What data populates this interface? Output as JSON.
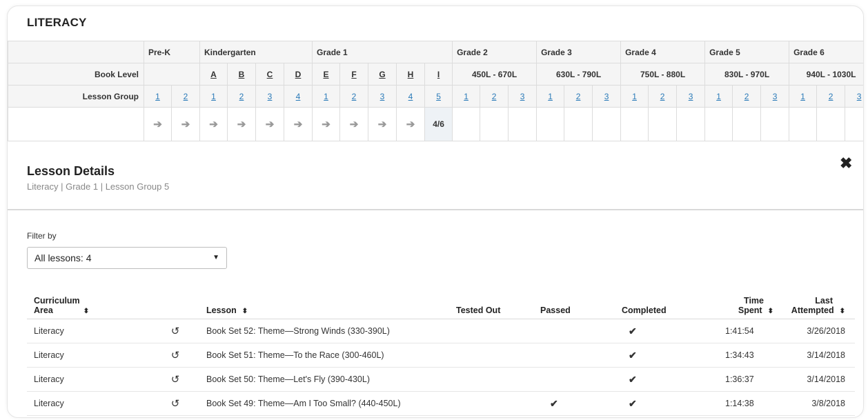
{
  "section_title": "LITERACY",
  "progress": {
    "grades": [
      {
        "label": "Pre-K"
      },
      {
        "label": "Kindergarten"
      },
      {
        "label": "Grade 1"
      },
      {
        "label": "Grade 2"
      },
      {
        "label": "Grade 3"
      },
      {
        "label": "Grade 4"
      },
      {
        "label": "Grade 5"
      },
      {
        "label": "Grade 6"
      }
    ],
    "book_level_label": "Book Level",
    "lesson_group_label": "Lesson Group",
    "book_levels": [
      "A",
      "B",
      "C",
      "D",
      "E",
      "F",
      "G",
      "H",
      "I"
    ],
    "ranges": [
      "450L - 670L",
      "630L - 790L",
      "750L - 880L",
      "830L - 970L",
      "940L - 1030L"
    ],
    "lesson_groups": [
      "1",
      "2",
      "1",
      "2",
      "3",
      "4",
      "1",
      "2",
      "3",
      "4",
      "5",
      "1",
      "2",
      "3",
      "1",
      "2",
      "3",
      "1",
      "2",
      "3",
      "1",
      "2",
      "3",
      "1",
      "2",
      "3"
    ],
    "current_progress": "4/6",
    "arrow_glyph": "➔"
  },
  "details": {
    "title": "Lesson Details",
    "breadcrumb": "Literacy | Grade 1 | Lesson Group 5",
    "close_glyph": "✖"
  },
  "filter": {
    "label": "Filter by",
    "selected": "All lessons: 4",
    "caret": "▼"
  },
  "lessons": {
    "headers": {
      "area_line1": "Curriculum",
      "area_line2": "Area",
      "lesson": "Lesson",
      "tested_out": "Tested Out",
      "passed": "Passed",
      "completed": "Completed",
      "time_line1": "Time",
      "time_line2": "Spent",
      "last_line1": "Last",
      "last_line2": "Attempted",
      "sort_glyph": "⬍"
    },
    "redo_glyph": "↺",
    "check_glyph": "✔",
    "rows": [
      {
        "area": "Literacy",
        "lesson": "Book Set 52: Theme—Strong Winds (330-390L)",
        "tested_out": "",
        "passed": "",
        "completed": "✔",
        "time": "1:41:54",
        "last": "3/26/2018"
      },
      {
        "area": "Literacy",
        "lesson": "Book Set 51: Theme—To the Race (300-460L)",
        "tested_out": "",
        "passed": "",
        "completed": "✔",
        "time": "1:34:43",
        "last": "3/14/2018"
      },
      {
        "area": "Literacy",
        "lesson": "Book Set 50: Theme—Let's Fly (390-430L)",
        "tested_out": "",
        "passed": "",
        "completed": "✔",
        "time": "1:36:37",
        "last": "3/14/2018"
      },
      {
        "area": "Literacy",
        "lesson": "Book Set 49: Theme—Am I Too Small? (440-450L)",
        "tested_out": "",
        "passed": "✔",
        "completed": "✔",
        "time": "1:14:38",
        "last": "3/8/2018"
      }
    ]
  },
  "colors": {
    "link_blue": "#2a7ab8",
    "check_blue": "#1f6aa3",
    "check_green": "#4aa93f",
    "arrow_gray": "#999999"
  }
}
